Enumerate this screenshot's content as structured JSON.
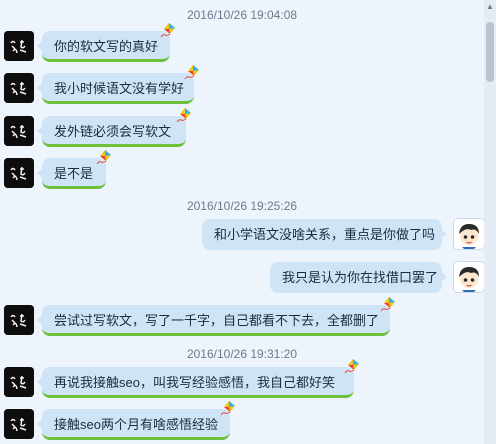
{
  "chat": {
    "items": [
      {
        "kind": "ts",
        "text": "2016/10/26 19:04:08"
      },
      {
        "kind": "msg",
        "side": "left",
        "text": "你的软文写的真好"
      },
      {
        "kind": "msg",
        "side": "left",
        "text": "我小时候语文没有学好"
      },
      {
        "kind": "msg",
        "side": "left",
        "text": "发外链必须会写软文"
      },
      {
        "kind": "msg",
        "side": "left",
        "text": "是不是"
      },
      {
        "kind": "ts",
        "text": "2016/10/26 19:25:26"
      },
      {
        "kind": "msg",
        "side": "right",
        "text": "和小学语文没啥关系，重点是你做了吗"
      },
      {
        "kind": "msg",
        "side": "right",
        "text": "我只是认为你在找借口罢了"
      },
      {
        "kind": "msg",
        "side": "left",
        "text": "尝试过写软文，写了一千字，自己都看不下去，全都删了"
      },
      {
        "kind": "ts",
        "text": "2016/10/26 19:31:20"
      },
      {
        "kind": "msg",
        "side": "left",
        "text": "再说我接触seo，叫我写经验感悟，我自己都好笑"
      },
      {
        "kind": "msg",
        "side": "left",
        "text": "接触seo两个月有啥感悟经验"
      }
    ]
  },
  "icons": {
    "left_avatar": "calligraphy-avatar-icon",
    "right_avatar": "cartoon-boy-avatar-icon",
    "bubble_decoration": "kite-icon"
  },
  "colors": {
    "background": "#eef4fb",
    "bubble": "#cfe4f7",
    "left_accent": "#6ec03c",
    "timestamp": "#6a7a8c"
  }
}
